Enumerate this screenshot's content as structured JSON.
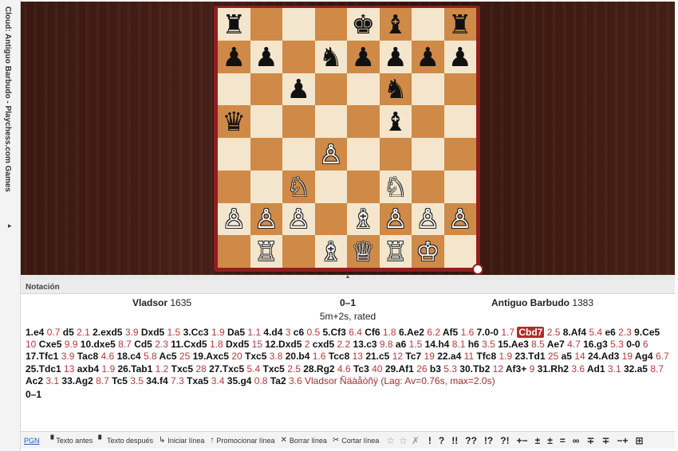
{
  "sidebar": {
    "title": "Cloud: Antiguo Barbudo - Playchess.com Games",
    "arrow": "▸"
  },
  "board": {
    "ranks": [
      [
        "♜",
        "",
        "",
        "",
        "♚",
        "♝",
        "",
        "♜"
      ],
      [
        "♟",
        "♟",
        "",
        "♞",
        "♟",
        "♟",
        "♟",
        "♟"
      ],
      [
        "",
        "",
        "♟",
        "",
        "",
        "♞",
        "",
        ""
      ],
      [
        "♛",
        "",
        "",
        "",
        "",
        "♝",
        "",
        ""
      ],
      [
        "",
        "",
        "",
        "♙",
        "",
        "",
        "",
        ""
      ],
      [
        "",
        "",
        "♘",
        "",
        "",
        "♘",
        "",
        ""
      ],
      [
        "♙",
        "♙",
        "♙",
        "",
        "♗",
        "♙",
        "♙",
        "♙"
      ],
      [
        "",
        "♖",
        "",
        "♗",
        "♕",
        "♖",
        "♔",
        ""
      ]
    ],
    "colors": [
      [
        "b",
        "",
        "",
        "",
        "b",
        "b",
        "",
        "b"
      ],
      [
        "b",
        "b",
        "",
        "b",
        "b",
        "b",
        "b",
        "b"
      ],
      [
        "",
        "",
        "b",
        "",
        "",
        "b",
        "",
        ""
      ],
      [
        "b",
        "",
        "",
        "",
        "",
        "b",
        "",
        ""
      ],
      [
        "",
        "",
        "",
        "w",
        "",
        "",
        "",
        ""
      ],
      [
        "",
        "",
        "w",
        "",
        "",
        "w",
        "",
        ""
      ],
      [
        "w",
        "w",
        "w",
        "",
        "w",
        "w",
        "w",
        "w"
      ],
      [
        "",
        "w",
        "",
        "w",
        "w",
        "w",
        "w",
        ""
      ]
    ]
  },
  "notation": {
    "header": "Notación",
    "white_name": "Vladsor",
    "white_elo": "1635",
    "black_name": "Antiguo Barbudo",
    "black_elo": "1383",
    "result": "0–1",
    "time_control": "5m+2s, rated",
    "moves": [
      [
        "1.e4",
        "0.7"
      ],
      [
        "d5",
        "2.1"
      ],
      [
        "2.exd5",
        "3.9"
      ],
      [
        "Dxd5",
        "1.5"
      ],
      [
        "3.Cc3",
        "1.9"
      ],
      [
        "Da5",
        "1.1"
      ],
      [
        "4.d4",
        "3"
      ],
      [
        "c6",
        "0.5"
      ],
      [
        "5.Cf3",
        "6.4"
      ],
      [
        "Cf6",
        "1.8"
      ],
      [
        "6.Ae2",
        "6.2"
      ],
      [
        "Af5",
        "1.6"
      ],
      [
        "7.0-0",
        "1.7"
      ],
      [
        "Cbd7",
        "2.5"
      ],
      [
        "8.Af4",
        "5.4"
      ],
      [
        "e6",
        "2.3"
      ],
      [
        "9.Ce5",
        "10"
      ],
      [
        "Cxe5",
        "9.9"
      ],
      [
        "10.dxe5",
        "8.7"
      ],
      [
        "Cd5",
        "2.3"
      ],
      [
        "11.Cxd5",
        "1.8"
      ],
      [
        "Dxd5",
        "15"
      ],
      [
        "12.Dxd5",
        "2"
      ],
      [
        "cxd5",
        "2.2"
      ],
      [
        "13.c3",
        "9.8"
      ],
      [
        "a6",
        "1.5"
      ],
      [
        "14.h4",
        "8.1"
      ],
      [
        "h6",
        "3.5"
      ],
      [
        "15.Ae3",
        "8.5"
      ],
      [
        "Ae7",
        "4.7"
      ],
      [
        "16.g3",
        "5.3"
      ],
      [
        "0-0",
        "6"
      ],
      [
        "17.Tfc1",
        "3.9"
      ],
      [
        "Tac8",
        "4.6"
      ],
      [
        "18.c4",
        "5.8"
      ],
      [
        "Ac5",
        "25"
      ],
      [
        "19.Axc5",
        "20"
      ],
      [
        "Txc5",
        "3.8"
      ],
      [
        "20.b4",
        "1.6"
      ],
      [
        "Tcc8",
        "13"
      ],
      [
        "21.c5",
        "12"
      ],
      [
        "Tc7",
        "19"
      ],
      [
        "22.a4",
        "11"
      ],
      [
        "Tfc8",
        "1.9"
      ],
      [
        "23.Td1",
        "25"
      ],
      [
        "a5",
        "14"
      ],
      [
        "24.Ad3",
        "19"
      ],
      [
        "Ag4",
        "6.7"
      ],
      [
        "25.Tdc1",
        "13"
      ],
      [
        "axb4",
        "1.9"
      ],
      [
        "26.Tab1",
        "1.2"
      ],
      [
        "Txc5",
        "28"
      ],
      [
        "27.Txc5",
        "5.4"
      ],
      [
        "Txc5",
        "2.5"
      ],
      [
        "28.Rg2",
        "4.6"
      ],
      [
        "Tc3",
        "40"
      ],
      [
        "29.Af1",
        "26"
      ],
      [
        "b3",
        "5.3"
      ],
      [
        "30.Tb2",
        "12"
      ],
      [
        "Af3+",
        "9"
      ],
      [
        "31.Rh2",
        "3.6"
      ],
      [
        "Ad1",
        "3.1"
      ],
      [
        "32.a5",
        "8.7"
      ],
      [
        "Ac2",
        "3.1"
      ],
      [
        "33.Ag2",
        "8.7"
      ],
      [
        "Tc5",
        "3.5"
      ],
      [
        "34.f4",
        "7.3"
      ],
      [
        "Txa5",
        "3.4"
      ],
      [
        "35.g4",
        "0.8"
      ],
      [
        "Ta2",
        "3.6"
      ]
    ],
    "current_move": "Cbd7",
    "comment": "Vladsor Ñäàåòñÿ (Lag: Av=0.76s, max=2.0s)",
    "result_bottom": "0–1"
  },
  "toolbar": {
    "pgn": "PGN",
    "items": [
      {
        "icon": "▝",
        "label": "Texto antes"
      },
      {
        "icon": "▘",
        "label": "Texto después"
      },
      {
        "icon": "↳",
        "label": "Iniciar línea"
      },
      {
        "icon": "↑",
        "label": "Promocionar línea"
      },
      {
        "icon": "✕",
        "label": "Borrar línea"
      },
      {
        "icon": "✂",
        "label": "Cortar línea"
      }
    ],
    "stars": [
      "☆",
      "☆",
      "✗"
    ],
    "symbols": [
      "!",
      "?",
      "!!",
      "??",
      "!?",
      "?!",
      "+−",
      "±",
      "±",
      "=",
      "∞",
      "∓",
      "∓",
      "−+",
      "⊞"
    ]
  },
  "colors": {
    "frame": "#8e1f1f",
    "light_square": "#f4e6cc",
    "dark_square": "#cf8a48",
    "current_move_bg": "#b62a2a",
    "clock_text": "#b23a3a"
  }
}
